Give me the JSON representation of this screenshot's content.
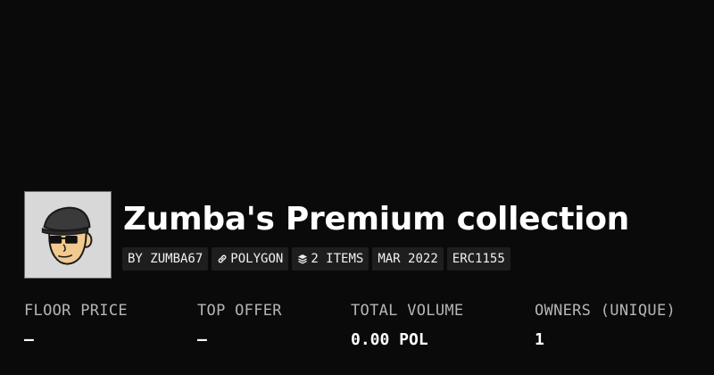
{
  "collection": {
    "title": "Zumba's Premium collection",
    "avatar_icon": "bald-man-sunglasses-flatcap-avatar"
  },
  "chips": [
    {
      "label": "BY ZUMBA67",
      "icon": null
    },
    {
      "label": "POLYGON",
      "icon": "link-icon"
    },
    {
      "label": "2 ITEMS",
      "icon": "layers-icon"
    },
    {
      "label": "MAR 2022",
      "icon": null
    },
    {
      "label": "ERC1155",
      "icon": null
    }
  ],
  "stats": {
    "floor_price": {
      "label": "FLOOR PRICE",
      "value": "—"
    },
    "top_offer": {
      "label": "TOP OFFER",
      "value": "—"
    },
    "total_volume": {
      "label": "TOTAL VOLUME",
      "value": "0.00 POL"
    },
    "owners": {
      "label": "OWNERS (UNIQUE)",
      "value": "1"
    }
  },
  "colors": {
    "background": "#0a0a0a",
    "chip_background": "#1e1e1e",
    "label_gray": "#b5b5b5"
  }
}
